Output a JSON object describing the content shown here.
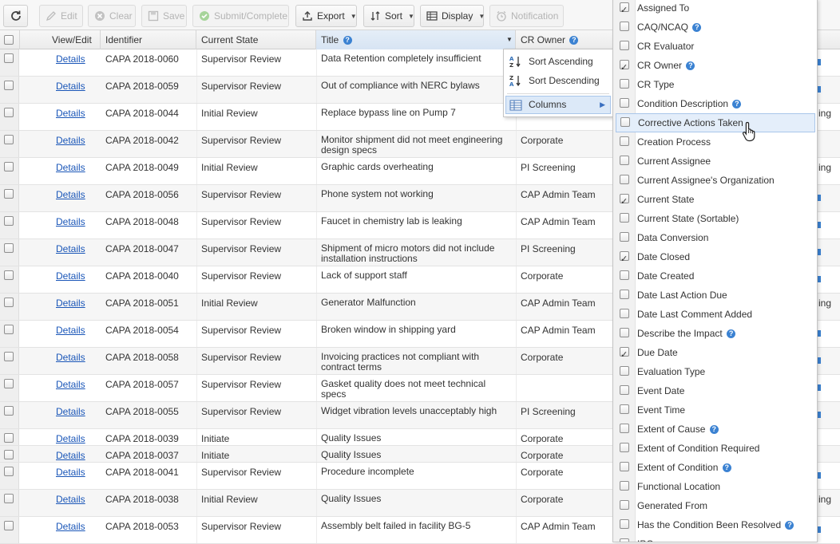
{
  "toolbar": {
    "refresh_icon": "refresh-icon",
    "edit": "Edit",
    "clear": "Clear",
    "save": "Save",
    "submit": "Submit/Complete",
    "export": "Export",
    "sort": "Sort",
    "display": "Display",
    "notification": "Notification"
  },
  "grid": {
    "headers": {
      "view_edit": "View/Edit",
      "identifier": "Identifier",
      "current_state": "Current State",
      "title": "Title",
      "cr_owner": "CR Owner"
    },
    "rows": [
      {
        "link": "Details",
        "id": "CAPA 2018-0060",
        "state": "Supervisor Review",
        "title": "Data Retention completely insufficient",
        "owner": ""
      },
      {
        "link": "Details",
        "id": "CAPA 2018-0059",
        "state": "Supervisor Review",
        "title": "Out of compliance with NERC bylaws",
        "owner": ""
      },
      {
        "link": "Details",
        "id": "CAPA 2018-0044",
        "state": "Initial Review",
        "title": "Replace bypass line on Pump 7",
        "owner": ""
      },
      {
        "link": "Details",
        "id": "CAPA 2018-0042",
        "state": "Supervisor Review",
        "title": "Monitor shipment did not meet engineering design specs",
        "owner": "Corporate"
      },
      {
        "link": "Details",
        "id": "CAPA 2018-0049",
        "state": "Initial Review",
        "title": "Graphic cards overheating",
        "owner": "PI Screening"
      },
      {
        "link": "Details",
        "id": "CAPA 2018-0056",
        "state": "Supervisor Review",
        "title": "Phone system not working",
        "owner": "CAP Admin Team"
      },
      {
        "link": "Details",
        "id": "CAPA 2018-0048",
        "state": "Supervisor Review",
        "title": "Faucet in chemistry lab is leaking",
        "owner": "CAP Admin Team"
      },
      {
        "link": "Details",
        "id": "CAPA 2018-0047",
        "state": "Supervisor Review",
        "title": "Shipment of micro motors did not include installation instructions",
        "owner": "PI Screening"
      },
      {
        "link": "Details",
        "id": "CAPA 2018-0040",
        "state": "Supervisor Review",
        "title": "Lack of support staff",
        "owner": "Corporate"
      },
      {
        "link": "Details",
        "id": "CAPA 2018-0051",
        "state": "Initial Review",
        "title": "Generator Malfunction",
        "owner": "CAP Admin Team"
      },
      {
        "link": "Details",
        "id": "CAPA 2018-0054",
        "state": "Supervisor Review",
        "title": "Broken window in shipping yard",
        "owner": "CAP Admin Team"
      },
      {
        "link": "Details",
        "id": "CAPA 2018-0058",
        "state": "Supervisor Review",
        "title": "Invoicing practices not compliant with contract terms",
        "owner": "Corporate"
      },
      {
        "link": "Details",
        "id": "CAPA 2018-0057",
        "state": "Supervisor Review",
        "title": "Gasket quality does not meet technical specs",
        "owner": ""
      },
      {
        "link": "Details",
        "id": "CAPA 2018-0055",
        "state": "Supervisor Review",
        "title": "Widget vibration levels unacceptably high",
        "owner": "PI Screening"
      },
      {
        "link": "Details",
        "id": "CAPA 2018-0039",
        "state": "Initiate",
        "title": "Quality Issues",
        "owner": "Corporate"
      },
      {
        "link": "Details",
        "id": "CAPA 2018-0037",
        "state": "Initiate",
        "title": "Quality Issues",
        "owner": "Corporate"
      },
      {
        "link": "Details",
        "id": "CAPA 2018-0041",
        "state": "Supervisor Review",
        "title": "Procedure incomplete",
        "owner": "Corporate"
      },
      {
        "link": "Details",
        "id": "CAPA 2018-0038",
        "state": "Initial Review",
        "title": "Quality Issues",
        "owner": "Corporate"
      },
      {
        "link": "Details",
        "id": "CAPA 2018-0053",
        "state": "Supervisor Review",
        "title": "Assembly belt failed in facility BG-5",
        "owner": "CAP Admin Team"
      }
    ],
    "right_bleed": [
      "ing",
      "ing",
      "ing",
      "ing"
    ]
  },
  "sort_menu": {
    "ascending": "Sort Ascending",
    "descending": "Sort Descending",
    "columns": "Columns"
  },
  "columns_panel": {
    "items": [
      {
        "label": "Assigned To",
        "checked": true,
        "help": false
      },
      {
        "label": "CAQ/NCAQ",
        "checked": false,
        "help": true
      },
      {
        "label": "CR Evaluator",
        "checked": false,
        "help": false
      },
      {
        "label": "CR Owner",
        "checked": true,
        "help": true
      },
      {
        "label": "CR Type",
        "checked": false,
        "help": false
      },
      {
        "label": "Condition Description",
        "checked": false,
        "help": true
      },
      {
        "label": "Corrective Actions Taken",
        "checked": false,
        "help": false
      },
      {
        "label": "Creation Process",
        "checked": false,
        "help": false
      },
      {
        "label": "Current Assignee",
        "checked": false,
        "help": false
      },
      {
        "label": "Current Assignee's Organization",
        "checked": false,
        "help": false
      },
      {
        "label": "Current State",
        "checked": true,
        "help": false
      },
      {
        "label": "Current State (Sortable)",
        "checked": false,
        "help": false
      },
      {
        "label": "Data Conversion",
        "checked": false,
        "help": false
      },
      {
        "label": "Date Closed",
        "checked": true,
        "help": false
      },
      {
        "label": "Date Created",
        "checked": false,
        "help": false
      },
      {
        "label": "Date Last Action Due",
        "checked": false,
        "help": false
      },
      {
        "label": "Date Last Comment Added",
        "checked": false,
        "help": false
      },
      {
        "label": "Describe the Impact",
        "checked": false,
        "help": true
      },
      {
        "label": "Due Date",
        "checked": true,
        "help": false
      },
      {
        "label": "Evaluation Type",
        "checked": false,
        "help": false
      },
      {
        "label": "Event Date",
        "checked": false,
        "help": false
      },
      {
        "label": "Event Time",
        "checked": false,
        "help": false
      },
      {
        "label": "Extent of Cause",
        "checked": false,
        "help": true
      },
      {
        "label": "Extent of Condition Required",
        "checked": false,
        "help": false
      },
      {
        "label": "Extent of Condition",
        "checked": false,
        "help": true
      },
      {
        "label": "Functional Location",
        "checked": false,
        "help": false
      },
      {
        "label": "Generated From",
        "checked": false,
        "help": false
      },
      {
        "label": "Has the Condition Been Resolved",
        "checked": false,
        "help": true
      },
      {
        "label": "IPO",
        "checked": false,
        "help": false
      }
    ],
    "highlighted": "Corrective Actions Taken"
  },
  "colors": {
    "link": "#1a56b8",
    "help_badge": "#3b82d2",
    "highlight": "#e4eefa"
  }
}
